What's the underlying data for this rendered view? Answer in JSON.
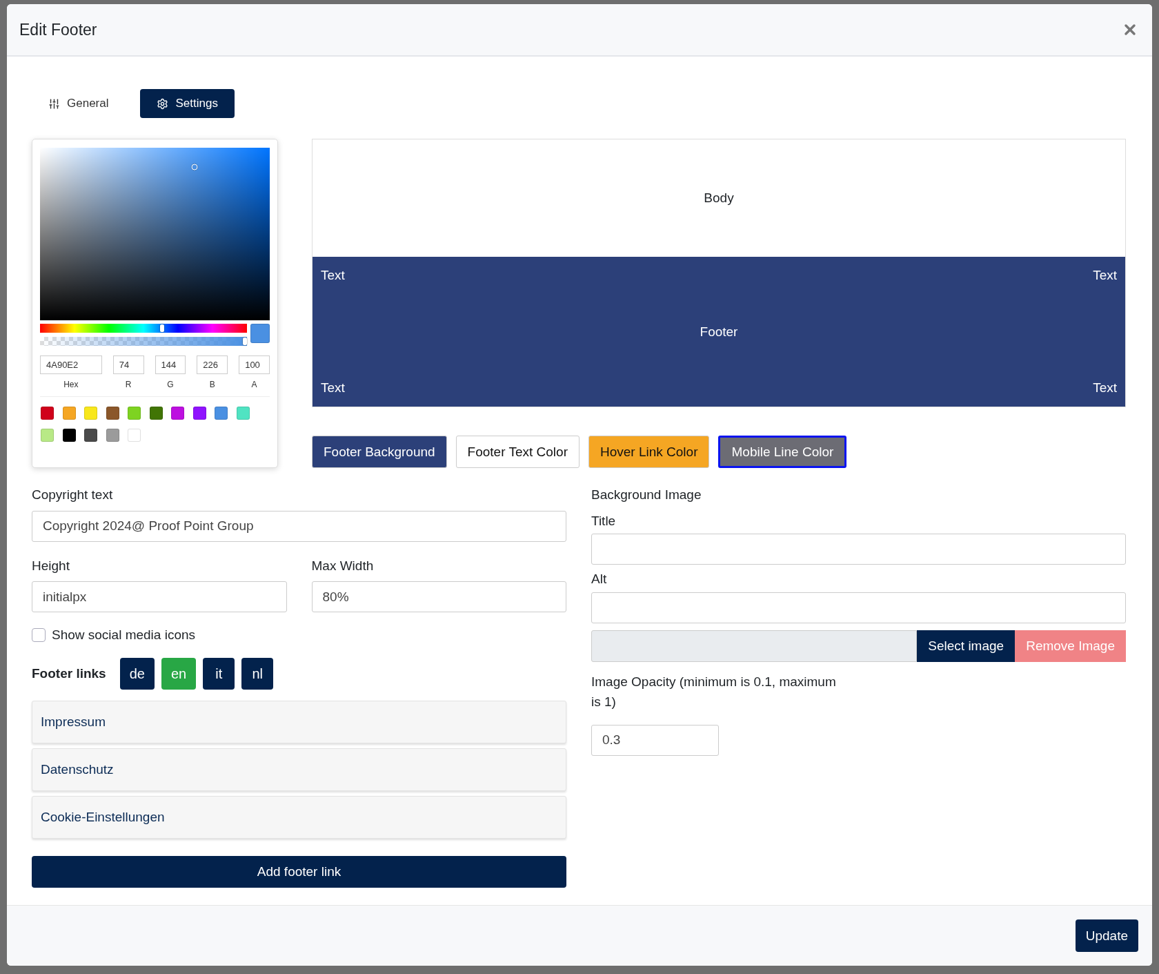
{
  "dialog": {
    "title": "Edit Footer",
    "update_button": "Update"
  },
  "tabs": [
    {
      "label": "General",
      "selected": false
    },
    {
      "label": "Settings",
      "selected": true
    }
  ],
  "picker": {
    "fields": [
      {
        "label": "Hex",
        "value": "4A90E2"
      },
      {
        "label": "R",
        "value": "74"
      },
      {
        "label": "G",
        "value": "144"
      },
      {
        "label": "B",
        "value": "226"
      },
      {
        "label": "A",
        "value": "100"
      }
    ],
    "swatches": [
      {
        "color": "#d0021b"
      },
      {
        "color": "#f5a623"
      },
      {
        "color": "#f8e71c"
      },
      {
        "color": "#8b572a"
      },
      {
        "color": "#7ed321"
      },
      {
        "color": "#417505"
      },
      {
        "color": "#bd10e0"
      },
      {
        "color": "#9013fe"
      },
      {
        "color": "#4a90e2"
      },
      {
        "color": "#50e3c2"
      },
      {
        "color": "#b8e986"
      },
      {
        "color": "#000000"
      },
      {
        "color": "#4a4a4a"
      },
      {
        "color": "#9b9b9b"
      },
      {
        "color": "#ffffff"
      }
    ]
  },
  "preview": {
    "body": "Body",
    "top_left": "Text",
    "top_right": "Text",
    "footer": "Footer",
    "bottom_left": "Text",
    "bottom_right": "Text"
  },
  "color_buttons": [
    {
      "label": "Footer Background",
      "color": "#2c4079",
      "selected": false
    },
    {
      "label": "Footer Text Color",
      "color": "#ffffff",
      "selected": false
    },
    {
      "label": "Hover Link Color",
      "color": "#f5a623",
      "selected": false
    },
    {
      "label": "Mobile Line Color",
      "color": "#6c6c74",
      "selected": true
    }
  ],
  "copyright": {
    "label": "Copyright text",
    "value": "Copyright 2024@ Proof Point Group"
  },
  "height": {
    "label": "Height",
    "value": "initialpx"
  },
  "max_width": {
    "label": "Max Width",
    "value": "80%"
  },
  "social_icons": {
    "label": "Show social media icons",
    "checked": false
  },
  "footer_links": {
    "label": "Footer links",
    "languages": [
      {
        "label": "de",
        "selected": false
      },
      {
        "label": "en",
        "selected": true
      },
      {
        "label": "it",
        "selected": false
      },
      {
        "label": "nl",
        "selected": false
      }
    ],
    "items": [
      "Impressum",
      "Datenschutz",
      "Cookie-Einstellungen"
    ],
    "add_button": "Add footer link"
  },
  "background_image": {
    "label": "Background Image",
    "title": {
      "label": "Title"
    },
    "alt": {
      "label": "Alt"
    },
    "select_button": "Select image",
    "remove_button": "Remove Image",
    "opacity": {
      "label": "Image Opacity (minimum is 0.1, maximum is 1)",
      "value": "0.3"
    }
  }
}
